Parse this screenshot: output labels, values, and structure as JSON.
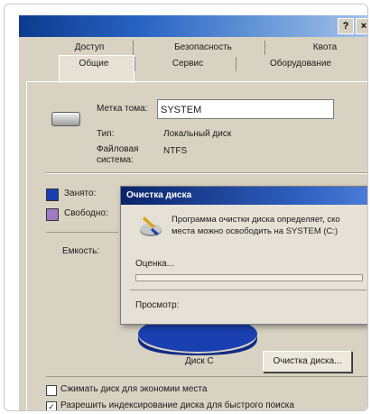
{
  "window": {
    "title": "",
    "help_label": "?",
    "close_label": "×"
  },
  "tabs": {
    "row1": [
      "Доступ",
      "Безопасность",
      "Квота"
    ],
    "row2": [
      "Общие",
      "Сервис",
      "Оборудование"
    ],
    "active": "Общие"
  },
  "general": {
    "label_name": "Метка тома:",
    "volume_name": "SYSTEM",
    "label_type": "Тип:",
    "type_value": "Локальный диск",
    "label_fs_line1": "Файловая",
    "label_fs_line2": "система:",
    "fs_value": "NTFS",
    "used_label": "Занято:",
    "free_label": "Свободно:",
    "capacity_label": "Емкость:",
    "drive_label": "Диск C",
    "cleanup_button": "Очистка диска..."
  },
  "colors": {
    "used": "#1a3fb0",
    "free": "#a079c7",
    "dialog_title_bg": "#0a246a"
  },
  "dialog": {
    "title": "Очистка диска",
    "message_line1": "Программа очистки диска определяет, ско",
    "message_line2": "места можно освободить на SYSTEM (C:)",
    "status_label": "Оценка...",
    "scan_label": "Просмотр:"
  },
  "options": {
    "compress_label": "Сжимать диск для экономии места",
    "index_label": "Разрешить индексирование диска для быстрого поиска",
    "compress_checked": false,
    "index_checked": true
  }
}
